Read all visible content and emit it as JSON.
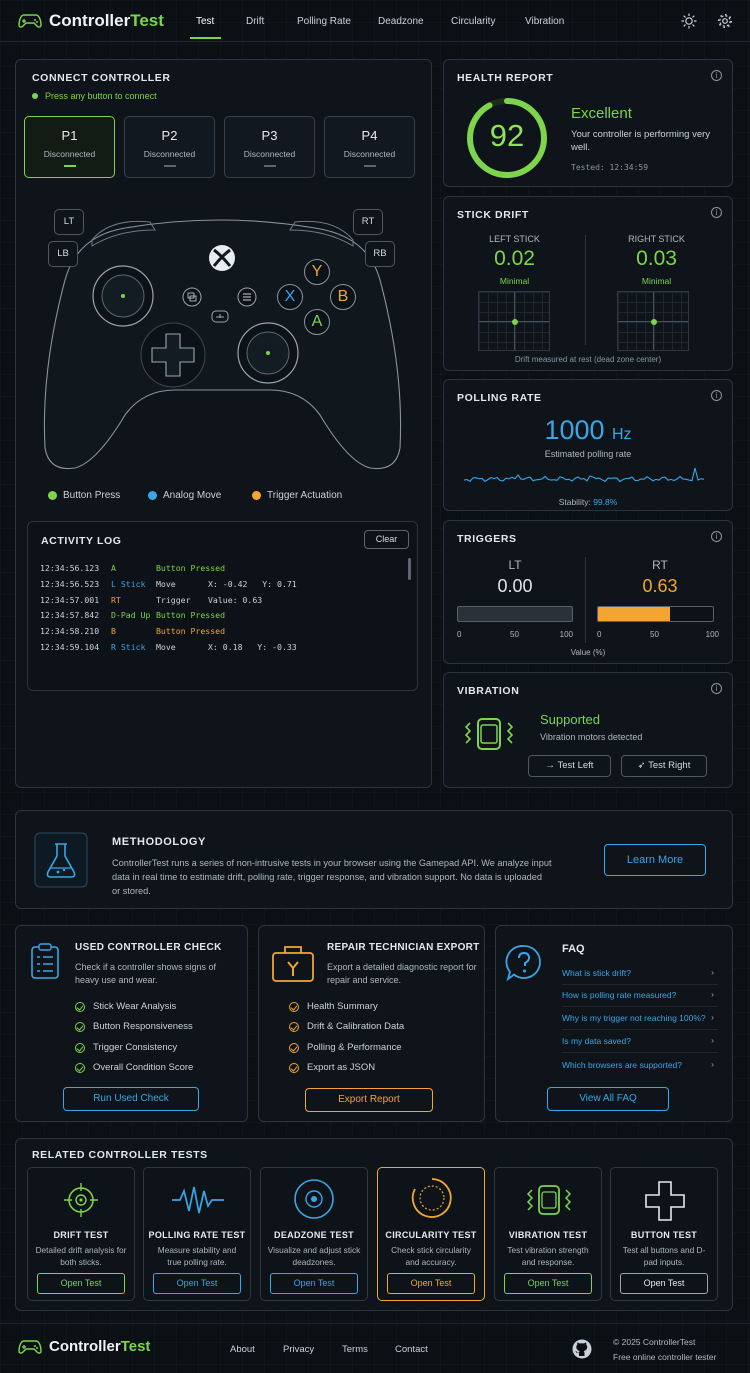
{
  "brand": {
    "name1": "Controller",
    "name2": "Test"
  },
  "nav": [
    "Test",
    "Drift",
    "Polling Rate",
    "Deadzone",
    "Circularity",
    "Vibration"
  ],
  "connect": {
    "title": "CONNECT CONTROLLER",
    "hint": "Press any button to connect",
    "players": [
      {
        "n": "P1",
        "s": "Disconnected"
      },
      {
        "n": "P2",
        "s": "Disconnected"
      },
      {
        "n": "P3",
        "s": "Disconnected"
      },
      {
        "n": "P4",
        "s": "Disconnected"
      }
    ]
  },
  "controller": {
    "lt": "LT",
    "lb": "LB",
    "rt": "RT",
    "rb": "RB",
    "y": "Y",
    "x": "X",
    "b": "B",
    "a": "A"
  },
  "legend": [
    "Button Press",
    "Analog Move",
    "Trigger Actuation"
  ],
  "log": {
    "title": "ACTIVITY LOG",
    "clear": "Clear",
    "rows": [
      [
        "12:34:56.123",
        "A",
        "Button Pressed",
        ""
      ],
      [
        "12:34:56.523",
        "L Stick",
        "Move",
        "X: -0.42   Y: 0.71"
      ],
      [
        "12:34:57.001",
        "RT",
        "Trigger",
        "Value: 0.63"
      ],
      [
        "12:34:57.842",
        "D-Pad Up",
        "Button Pressed",
        ""
      ],
      [
        "12:34:58.210",
        "B",
        "Button Pressed",
        ""
      ],
      [
        "12:34:59.104",
        "R Stick",
        "Move",
        "X: 0.18   Y: -0.33"
      ]
    ]
  },
  "health": {
    "title": "HEALTH REPORT",
    "score": "92",
    "score_value": 92,
    "status": "Excellent",
    "desc": "Your controller is performing very well.",
    "tested": "Tested: 12:34:59"
  },
  "drift": {
    "title": "STICK DRIFT",
    "left": {
      "label": "LEFT STICK",
      "value": "0.02",
      "status": "Minimal"
    },
    "right": {
      "label": "RIGHT STICK",
      "value": "0.03",
      "status": "Minimal"
    },
    "note": "Drift measured at rest (dead zone center)"
  },
  "polling": {
    "title": "POLLING RATE",
    "value": "1000",
    "unit": "Hz",
    "sub": "Estimated polling rate",
    "stability_label": "Stability:",
    "stability": "99.8%"
  },
  "triggers": {
    "title": "TRIGGERS",
    "lt": {
      "label": "LT",
      "value": "0.00",
      "frac": 0.0
    },
    "rt": {
      "label": "RT",
      "value": "0.63",
      "frac": 0.63
    },
    "ticks": [
      "0",
      "50",
      "100"
    ],
    "axis": "Value (%)"
  },
  "vibration": {
    "title": "VIBRATION",
    "status": "Supported",
    "sub": "Vibration motors detected",
    "left": "Test Left",
    "right": "Test Right"
  },
  "methodology": {
    "title": "METHODOLOGY",
    "text": "ControllerTest runs a series of non-intrusive tests in your browser using the Gamepad API. We analyze input data in real time to estimate drift, polling rate, trigger response, and vibration support. No data is uploaded or stored.",
    "button": "Learn More"
  },
  "used": {
    "title": "USED CONTROLLER CHECK",
    "desc": "Check if a controller shows signs of heavy use and wear.",
    "items": [
      "Stick Wear Analysis",
      "Button Responsiveness",
      "Trigger Consistency",
      "Overall Condition Score"
    ],
    "button": "Run Used Check"
  },
  "repair": {
    "title": "REPAIR TECHNICIAN EXPORT",
    "desc": "Export a detailed diagnostic report for repair and service.",
    "items": [
      "Health Summary",
      "Drift & Calibration Data",
      "Polling & Performance",
      "Export as JSON"
    ],
    "button": "Export Report"
  },
  "faq": {
    "title": "FAQ",
    "items": [
      "What is stick drift?",
      "How is polling rate measured?",
      "Why is my trigger not reaching 100%?",
      "Is my data saved?",
      "Which browsers are supported?"
    ],
    "button": "View All FAQ"
  },
  "related": {
    "title": "RELATED CONTROLLER TESTS",
    "cards": [
      {
        "t": "DRIFT TEST",
        "d": "Detailed drift analysis for both sticks.",
        "b": "Open Test"
      },
      {
        "t": "POLLING RATE TEST",
        "d": "Measure stability and true polling rate.",
        "b": "Open Test"
      },
      {
        "t": "DEADZONE TEST",
        "d": "Visualize and adjust stick deadzones.",
        "b": "Open Test"
      },
      {
        "t": "CIRCULARITY TEST",
        "d": "Check stick circularity and accuracy.",
        "b": "Open Test"
      },
      {
        "t": "VIBRATION TEST",
        "d": "Test vibration strength and response.",
        "b": "Open Test"
      },
      {
        "t": "BUTTON TEST",
        "d": "Test all buttons and D-pad inputs.",
        "b": "Open Test"
      }
    ]
  },
  "footer": {
    "links": [
      "About",
      "Privacy",
      "Terms",
      "Contact"
    ],
    "copy": "© 2025 ControllerTest",
    "tag": "Free online controller tester"
  },
  "colors": {
    "green": "#7ed44a",
    "blue": "#3aa6e6",
    "orange": "#f2a531",
    "bg": "#0b1015"
  }
}
